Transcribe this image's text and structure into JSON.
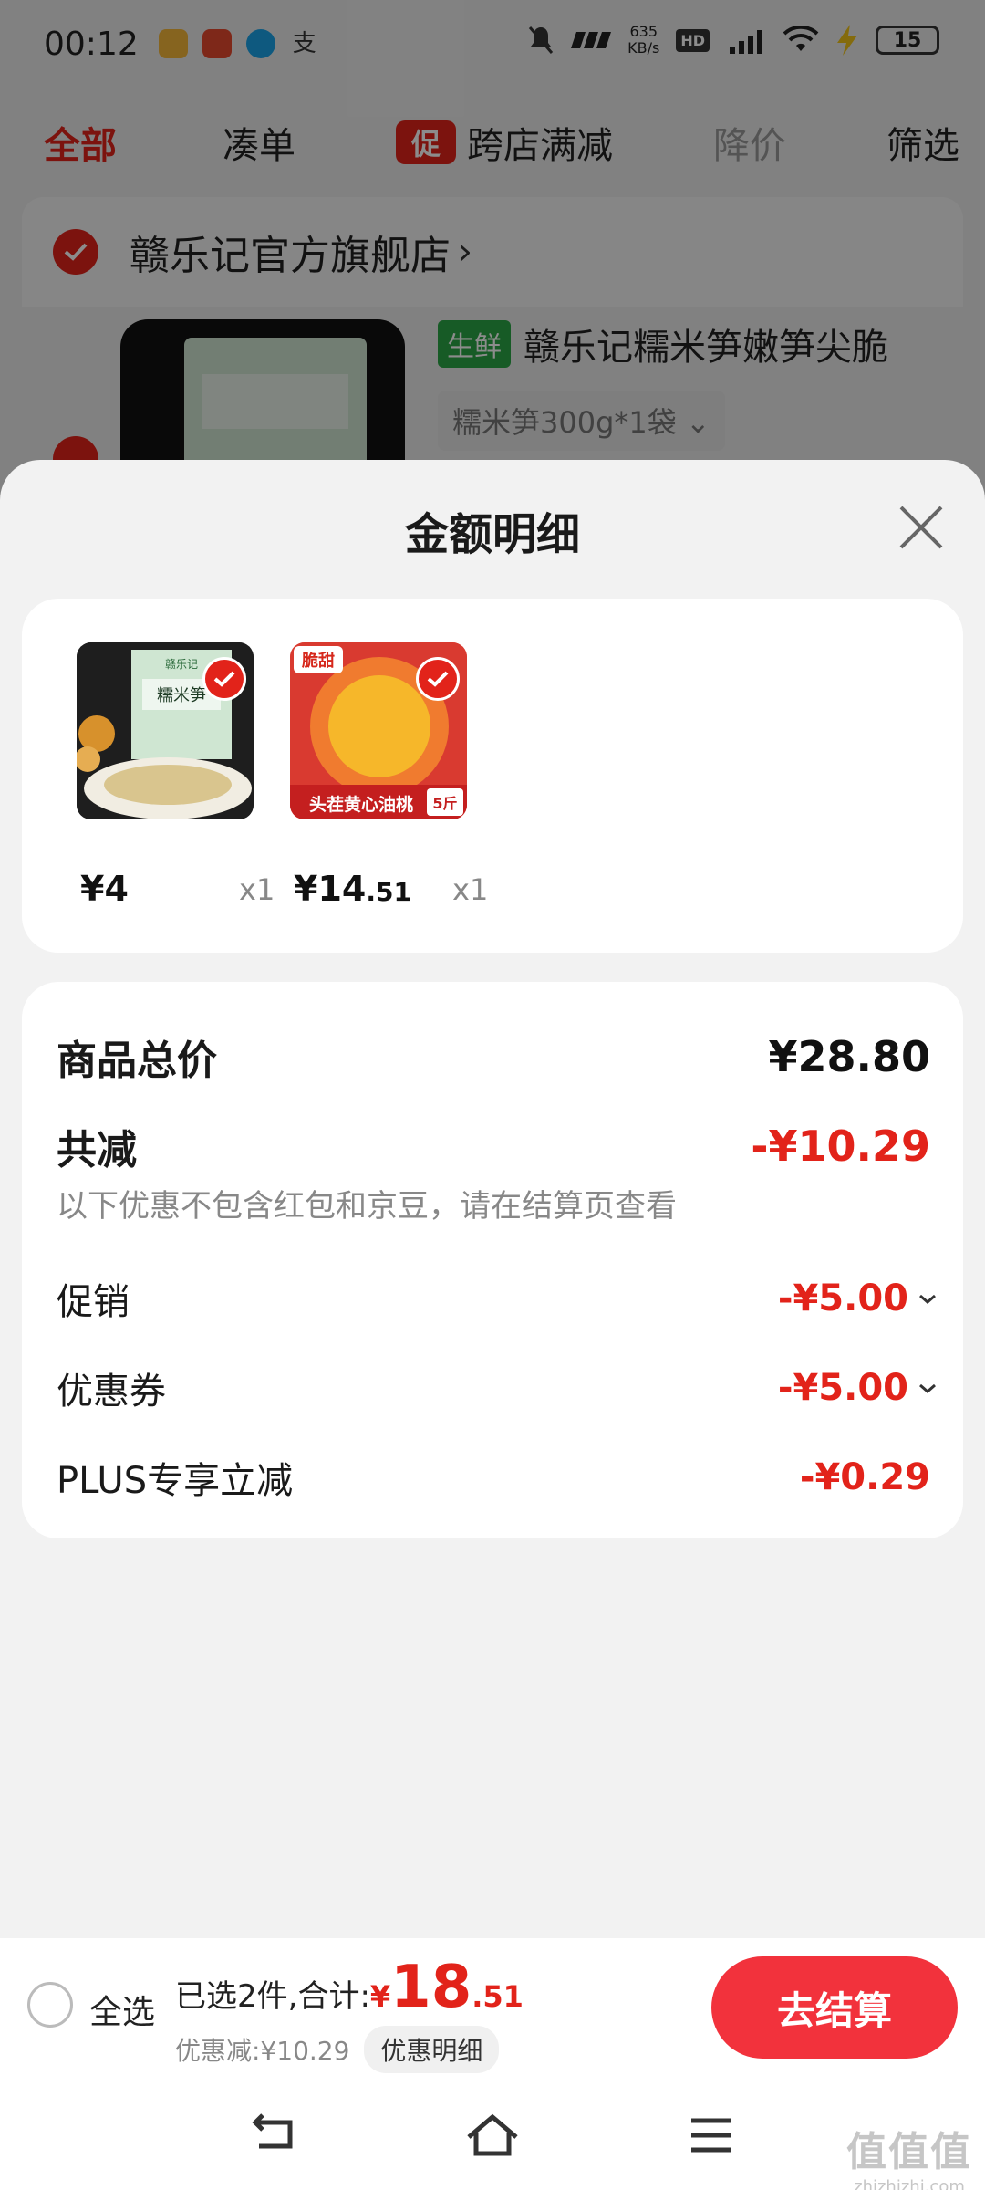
{
  "status_bar": {
    "time": "00:12",
    "net_speed_value": "635",
    "net_speed_unit": "KB/s",
    "hd": "HD",
    "battery": "15"
  },
  "filter_tabs": {
    "all": "全部",
    "bundle": "凑单",
    "promo_tag": "促",
    "cross_store": "跨店满减",
    "price_drop": "降价",
    "filter": "筛选"
  },
  "store": {
    "name": "赣乐记官方旗舰店",
    "arrow": "›"
  },
  "product": {
    "fresh_tag": "生鲜",
    "name": "赣乐记糯米笋嫩笋尖脆",
    "spec": "糯米笋300g*1袋 ⌄"
  },
  "sheet": {
    "title": "金额明细",
    "items": [
      {
        "price_main": "¥4",
        "price_decimal": "",
        "qty": "x1"
      },
      {
        "price_main": "¥14",
        "price_decimal": ".51",
        "qty": "x1"
      }
    ],
    "thumb2_top_label": "脆甜",
    "thumb2_bottom_label": "头茬黄心油桃",
    "thumb2_weight": "5斤",
    "thumb1_brand": "赣乐记",
    "thumb1_product": "糯米笋",
    "summary": {
      "total_label": "商品总价",
      "total_value": "¥28.80",
      "discount_label": "共减",
      "discount_value": "-¥10.29",
      "discount_note": "以下优惠不包含红包和京豆，请在结算页查看",
      "promo_label": "促销",
      "promo_value": "-¥5.00",
      "coupon_label": "优惠券",
      "coupon_value": "-¥5.00",
      "plus_label": "PLUS专享立减",
      "plus_value": "-¥0.29"
    }
  },
  "checkout": {
    "select_all": "全选",
    "selected_text": "已选2件,合计:",
    "currency": "¥",
    "total_int": "18",
    "total_dec": ".51",
    "discount_text": "优惠减:¥10.29",
    "detail_label": "优惠明细",
    "button": "去结算"
  },
  "watermark": {
    "logo": "值值值",
    "url": "zhizhizhi.com"
  },
  "colors": {
    "accent": "#e2231a",
    "checkout_button": "#f2323c",
    "fresh_tag": "#2aa745"
  }
}
